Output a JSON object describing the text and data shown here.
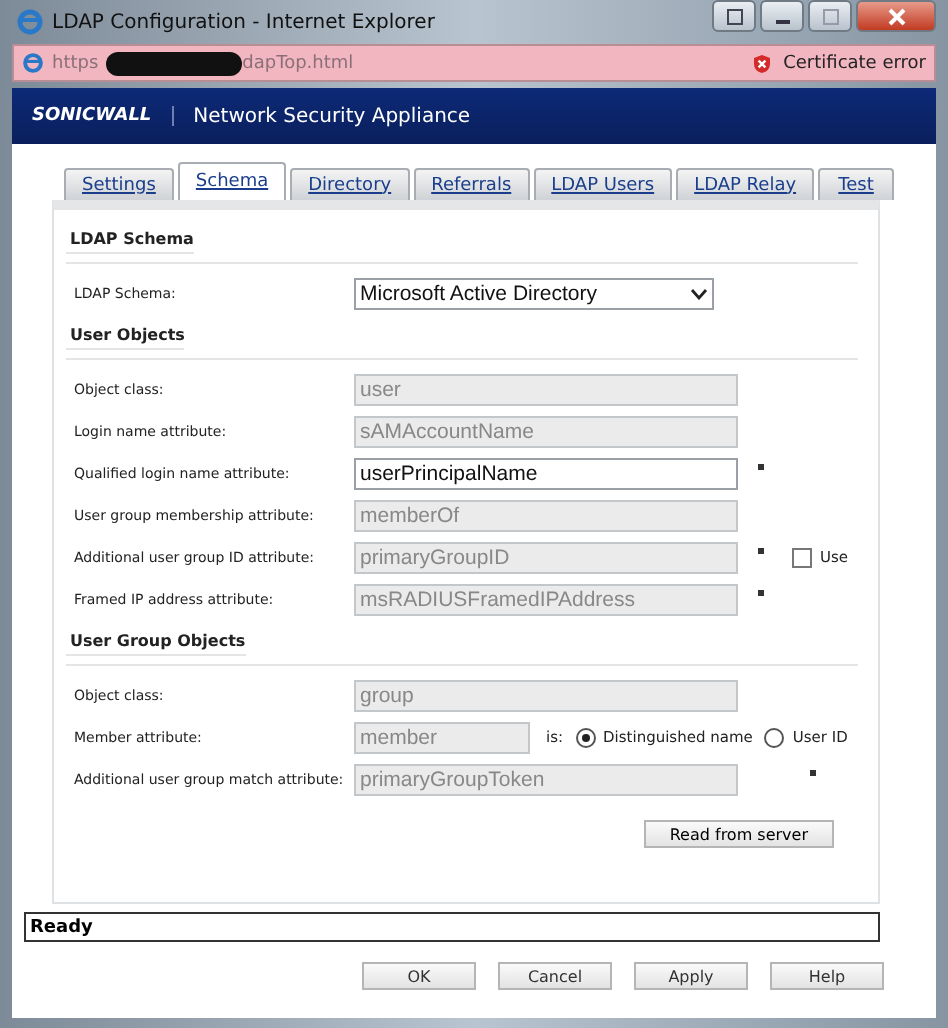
{
  "window": {
    "title": "LDAP Configuration - Internet Explorer"
  },
  "address_bar": {
    "url_start": "https",
    "url_end": "dapTop.html",
    "certificate_status": "Certificate error"
  },
  "header": {
    "logo": "SONICWALL",
    "product": "Network Security Appliance"
  },
  "tabs": [
    {
      "label": "Settings",
      "selected": false
    },
    {
      "label": "Schema",
      "selected": true
    },
    {
      "label": "Directory",
      "selected": false
    },
    {
      "label": "Referrals",
      "selected": false
    },
    {
      "label": "LDAP Users",
      "selected": false
    },
    {
      "label": "LDAP Relay",
      "selected": false
    },
    {
      "label": "Test",
      "selected": false
    }
  ],
  "sections": [
    {
      "heading": "LDAP Schema",
      "rows": [
        {
          "kind": "select",
          "label": "LDAP Schema:",
          "value": "Microsoft Active Directory"
        }
      ]
    },
    {
      "heading": "User Objects",
      "rows": [
        {
          "kind": "text",
          "label": "Object class:",
          "value": "user",
          "disabled": true,
          "marker": false
        },
        {
          "kind": "text",
          "label": "Login name attribute:",
          "value": "sAMAccountName",
          "disabled": true,
          "marker": false
        },
        {
          "kind": "text",
          "label": "Qualified login name attribute:",
          "value": "userPrincipalName",
          "disabled": false,
          "marker": true
        },
        {
          "kind": "text",
          "label": "User group membership attribute:",
          "value": "memberOf",
          "disabled": true,
          "marker": false
        },
        {
          "kind": "check",
          "label": "Additional user group ID attribute:",
          "value": "primaryGroupID",
          "disabled": true,
          "marker": true,
          "check_label": "Use",
          "checked": false
        },
        {
          "kind": "text",
          "label": "Framed IP address attribute:",
          "value": "msRADIUSFramedIPAddress",
          "disabled": true,
          "marker": true
        }
      ]
    },
    {
      "heading": "User Group Objects",
      "rows": [
        {
          "kind": "text",
          "label": "Object class:",
          "value": "group",
          "disabled": true,
          "marker": false
        },
        {
          "kind": "radio",
          "label": "Member attribute:",
          "value": "member",
          "disabled": true,
          "connector": "is:",
          "options": [
            {
              "label": "Distinguished name",
              "selected": true
            },
            {
              "label": "User ID",
              "selected": false
            }
          ]
        },
        {
          "kind": "text",
          "label": "Additional user group match attribute:",
          "value": "primaryGroupToken",
          "disabled": true,
          "marker": true,
          "marker_far": true
        }
      ]
    }
  ],
  "read_button": "Read from server",
  "status_bar": {
    "text": "Ready"
  },
  "buttons": [
    "OK",
    "Cancel",
    "Apply",
    "Help"
  ]
}
